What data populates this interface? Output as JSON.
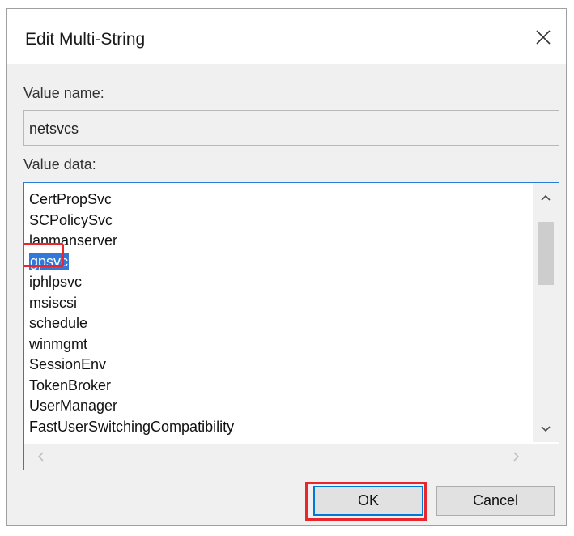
{
  "dialog": {
    "title": "Edit Multi-String",
    "close_glyph": "✕",
    "value_name_label": "Value name:",
    "value_name": "netsvcs",
    "value_data_label": "Value data:",
    "value_data_lines": [
      "CertPropSvc",
      "SCPolicySvc",
      "lanmanserver",
      "gpsvc",
      "iphlpsvc",
      "msiscsi",
      "schedule",
      "winmgmt",
      "SessionEnv",
      "TokenBroker",
      "UserManager",
      "FastUserSwitchingCompatibility"
    ],
    "selected_line": "gpsvc",
    "highlight_color": "#e8262c",
    "selection_color": "#3178d8",
    "ok_label": "OK",
    "cancel_label": "Cancel"
  },
  "icons": {
    "close": "close-icon",
    "scroll_up": "chevron-up-icon",
    "scroll_down": "chevron-down-icon",
    "scroll_left": "chevron-left-icon",
    "scroll_right": "chevron-right-icon"
  }
}
